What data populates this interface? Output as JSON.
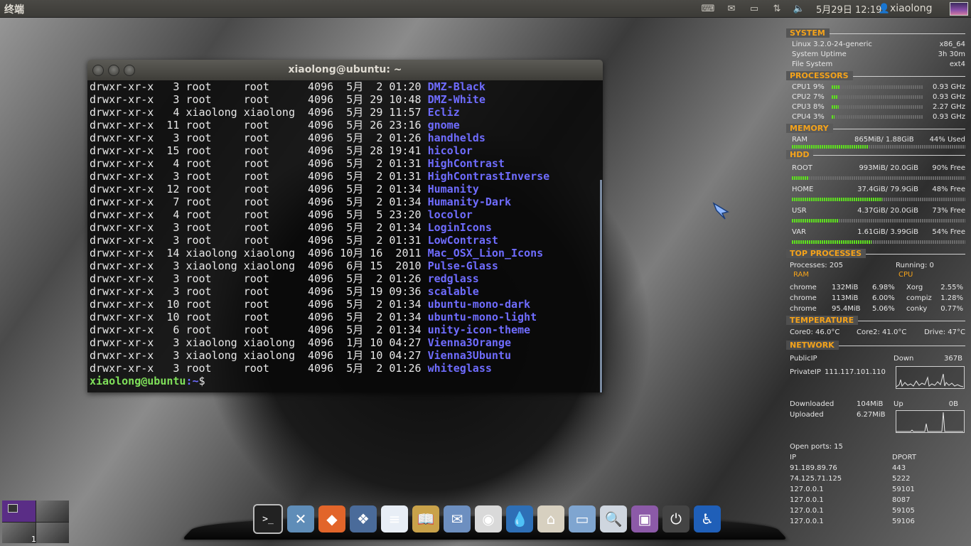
{
  "top_panel": {
    "app_title": "终端",
    "clock": "5月29日 12:19",
    "user": "xiaolong",
    "tray_icons": [
      "keyboard-icon",
      "mail-icon",
      "battery-icon",
      "network-icon",
      "volume-icon"
    ]
  },
  "terminal": {
    "title": "xiaolong@ubuntu: ~",
    "rows": [
      {
        "perm": "drwxr-xr-x",
        "links": "3",
        "owner": "root",
        "group": "root",
        "size": "4096",
        "month": "5月",
        "day": "2",
        "time": "01:20",
        "name": "DMZ-Black"
      },
      {
        "perm": "drwxr-xr-x",
        "links": "3",
        "owner": "root",
        "group": "root",
        "size": "4096",
        "month": "5月",
        "day": "29",
        "time": "10:48",
        "name": "DMZ-White"
      },
      {
        "perm": "drwxr-xr-x",
        "links": "4",
        "owner": "xiaolong",
        "group": "xiaolong",
        "size": "4096",
        "month": "5月",
        "day": "29",
        "time": "11:57",
        "name": "Ecliz"
      },
      {
        "perm": "drwxr-xr-x",
        "links": "11",
        "owner": "root",
        "group": "root",
        "size": "4096",
        "month": "5月",
        "day": "26",
        "time": "23:16",
        "name": "gnome"
      },
      {
        "perm": "drwxr-xr-x",
        "links": "3",
        "owner": "root",
        "group": "root",
        "size": "4096",
        "month": "5月",
        "day": "2",
        "time": "01:26",
        "name": "handhelds"
      },
      {
        "perm": "drwxr-xr-x",
        "links": "15",
        "owner": "root",
        "group": "root",
        "size": "4096",
        "month": "5月",
        "day": "28",
        "time": "19:41",
        "name": "hicolor"
      },
      {
        "perm": "drwxr-xr-x",
        "links": "4",
        "owner": "root",
        "group": "root",
        "size": "4096",
        "month": "5月",
        "day": "2",
        "time": "01:31",
        "name": "HighContrast"
      },
      {
        "perm": "drwxr-xr-x",
        "links": "3",
        "owner": "root",
        "group": "root",
        "size": "4096",
        "month": "5月",
        "day": "2",
        "time": "01:31",
        "name": "HighContrastInverse"
      },
      {
        "perm": "drwxr-xr-x",
        "links": "12",
        "owner": "root",
        "group": "root",
        "size": "4096",
        "month": "5月",
        "day": "2",
        "time": "01:34",
        "name": "Humanity"
      },
      {
        "perm": "drwxr-xr-x",
        "links": "7",
        "owner": "root",
        "group": "root",
        "size": "4096",
        "month": "5月",
        "day": "2",
        "time": "01:34",
        "name": "Humanity-Dark"
      },
      {
        "perm": "drwxr-xr-x",
        "links": "4",
        "owner": "root",
        "group": "root",
        "size": "4096",
        "month": "5月",
        "day": "5",
        "time": "23:20",
        "name": "locolor"
      },
      {
        "perm": "drwxr-xr-x",
        "links": "3",
        "owner": "root",
        "group": "root",
        "size": "4096",
        "month": "5月",
        "day": "2",
        "time": "01:34",
        "name": "LoginIcons"
      },
      {
        "perm": "drwxr-xr-x",
        "links": "3",
        "owner": "root",
        "group": "root",
        "size": "4096",
        "month": "5月",
        "day": "2",
        "time": "01:31",
        "name": "LowContrast"
      },
      {
        "perm": "drwxr-xr-x",
        "links": "14",
        "owner": "xiaolong",
        "group": "xiaolong",
        "size": "4096",
        "month": "10月",
        "day": "16",
        "time": "2011",
        "name": "Mac_OSX_Lion_Icons"
      },
      {
        "perm": "drwxr-xr-x",
        "links": "3",
        "owner": "xiaolong",
        "group": "xiaolong",
        "size": "4096",
        "month": "6月",
        "day": "15",
        "time": "2010",
        "name": "Pulse-Glass"
      },
      {
        "perm": "drwxr-xr-x",
        "links": "3",
        "owner": "root",
        "group": "root",
        "size": "4096",
        "month": "5月",
        "day": "2",
        "time": "01:26",
        "name": "redglass"
      },
      {
        "perm": "drwxr-xr-x",
        "links": "3",
        "owner": "root",
        "group": "root",
        "size": "4096",
        "month": "5月",
        "day": "19",
        "time": "09:36",
        "name": "scalable"
      },
      {
        "perm": "drwxr-xr-x",
        "links": "10",
        "owner": "root",
        "group": "root",
        "size": "4096",
        "month": "5月",
        "day": "2",
        "time": "01:34",
        "name": "ubuntu-mono-dark"
      },
      {
        "perm": "drwxr-xr-x",
        "links": "10",
        "owner": "root",
        "group": "root",
        "size": "4096",
        "month": "5月",
        "day": "2",
        "time": "01:34",
        "name": "ubuntu-mono-light"
      },
      {
        "perm": "drwxr-xr-x",
        "links": "6",
        "owner": "root",
        "group": "root",
        "size": "4096",
        "month": "5月",
        "day": "2",
        "time": "01:34",
        "name": "unity-icon-theme"
      },
      {
        "perm": "drwxr-xr-x",
        "links": "3",
        "owner": "xiaolong",
        "group": "xiaolong",
        "size": "4096",
        "month": "1月",
        "day": "10",
        "time": "04:27",
        "name": "Vienna3Orange"
      },
      {
        "perm": "drwxr-xr-x",
        "links": "3",
        "owner": "xiaolong",
        "group": "xiaolong",
        "size": "4096",
        "month": "1月",
        "day": "10",
        "time": "04:27",
        "name": "Vienna3Ubuntu"
      },
      {
        "perm": "drwxr-xr-x",
        "links": "3",
        "owner": "root",
        "group": "root",
        "size": "4096",
        "month": "5月",
        "day": "2",
        "time": "01:26",
        "name": "whiteglass"
      }
    ],
    "prompt_user": "xiaolong@ubuntu",
    "prompt_path": ":~",
    "prompt_symbol": "$"
  },
  "conky": {
    "system": {
      "title": "SYSTEM",
      "kernel": "Linux 3.2.0-24-generic",
      "arch": "x86_64",
      "uptime_label": "System Uptime",
      "uptime": "3h 30m",
      "fs_label": "File System",
      "fs": "ext4"
    },
    "processors": {
      "title": "PROCESSORS",
      "cpus": [
        {
          "label": "CPU1 9%",
          "freq": "0.93 GHz",
          "load": 0.09
        },
        {
          "label": "CPU2 7%",
          "freq": "0.93 GHz",
          "load": 0.07
        },
        {
          "label": "CPU3 8%",
          "freq": "2.27 GHz",
          "load": 0.08
        },
        {
          "label": "CPU4 3%",
          "freq": "0.93 GHz",
          "load": 0.03
        }
      ]
    },
    "memory": {
      "title": "MEMORY",
      "label": "RAM",
      "usage": "865MiB/ 1.88GiB",
      "pct": "44% Used",
      "fill": 0.44
    },
    "hdd": {
      "title": "HDD",
      "disks": [
        {
          "label": "ROOT",
          "usage": "993MiB/ 20.0GiB",
          "free": "90% Free",
          "fill": 0.1
        },
        {
          "label": "HOME",
          "usage": "37.4GiB/ 79.9GiB",
          "free": "48% Free",
          "fill": 0.52
        },
        {
          "label": "USR",
          "usage": "4.37GiB/ 20.0GiB",
          "free": "73% Free",
          "fill": 0.27
        },
        {
          "label": "VAR",
          "usage": "1.61GiB/ 3.99GiB",
          "free": "54% Free",
          "fill": 0.46
        }
      ]
    },
    "top": {
      "title": "TOP PROCESSES",
      "processes": "Processes: 205",
      "running": "Running: 0",
      "ram_label": "RAM",
      "cpu_label": "CPU",
      "ram_rows": [
        {
          "name": "chrome",
          "mem": "132MiB",
          "pct": "6.98%"
        },
        {
          "name": "chrome",
          "mem": "113MiB",
          "pct": "6.00%"
        },
        {
          "name": "chrome",
          "mem": "95.4MiB",
          "pct": "5.06%"
        }
      ],
      "cpu_rows": [
        {
          "name": "Xorg",
          "pct": "2.55%"
        },
        {
          "name": "compiz",
          "pct": "1.28%"
        },
        {
          "name": "conky",
          "pct": "0.77%"
        }
      ]
    },
    "temperature": {
      "title": "TEMPERATURE",
      "core0": "Core0: 46.0°C",
      "core2": "Core2: 41.0°C",
      "drive": "Drive: 47°C"
    },
    "network": {
      "title": "NETWORK",
      "public_ip_label": "PublicIP",
      "down_label": "Down",
      "down": "367B",
      "private_ip_label": "PrivateIP",
      "private_ip": "111.117.101.110",
      "downloaded_label": "Downloaded",
      "downloaded": "104MiB",
      "up_label": "Up",
      "up": "0B",
      "uploaded_label": "Uploaded",
      "uploaded": "6.27MiB",
      "open_ports": "Open ports: 15",
      "ip_header": "IP",
      "dport_header": "DPORT",
      "connections": [
        {
          "ip": "91.189.89.76",
          "port": "443"
        },
        {
          "ip": "74.125.71.125",
          "port": "5222"
        },
        {
          "ip": "127.0.0.1",
          "port": "59101"
        },
        {
          "ip": "127.0.0.1",
          "port": "8087"
        },
        {
          "ip": "127.0.0.1",
          "port": "59105"
        },
        {
          "ip": "127.0.0.1",
          "port": "59106"
        }
      ]
    }
  },
  "workspaces": {
    "current": "1"
  },
  "dock": {
    "items": [
      {
        "name": "terminal-icon",
        "glyph": ">_",
        "color": "#222"
      },
      {
        "name": "tools-folder-icon",
        "glyph": "✕",
        "color": "#5f8db8"
      },
      {
        "name": "shopping-bag-icon",
        "glyph": "◆",
        "color": "#e2652a"
      },
      {
        "name": "photo-viewer-icon",
        "glyph": "❖",
        "color": "#4a6b9a"
      },
      {
        "name": "document-editor-icon",
        "glyph": "≡",
        "color": "#e8eef6"
      },
      {
        "name": "dictionary-icon",
        "glyph": "📖",
        "color": "#c9a24a"
      },
      {
        "name": "mail-stamp-icon",
        "glyph": "✉",
        "color": "#6d8fc0"
      },
      {
        "name": "chrome-icon",
        "glyph": "◉",
        "color": "#d9d9d9"
      },
      {
        "name": "water-drop-icon",
        "glyph": "💧",
        "color": "#2e6fb6"
      },
      {
        "name": "home-folder-icon",
        "glyph": "⌂",
        "color": "#d7d0c0"
      },
      {
        "name": "folder-icon",
        "glyph": "▭",
        "color": "#7fa5d0"
      },
      {
        "name": "search-magnifier-icon",
        "glyph": "🔍",
        "color": "#cfd6df"
      },
      {
        "name": "screenshot-icon",
        "glyph": "▣",
        "color": "#8c5aa8"
      },
      {
        "name": "power-icon",
        "glyph": "⏻",
        "color": "#444"
      },
      {
        "name": "accessibility-icon",
        "glyph": "♿",
        "color": "#1f5fb8"
      }
    ]
  }
}
